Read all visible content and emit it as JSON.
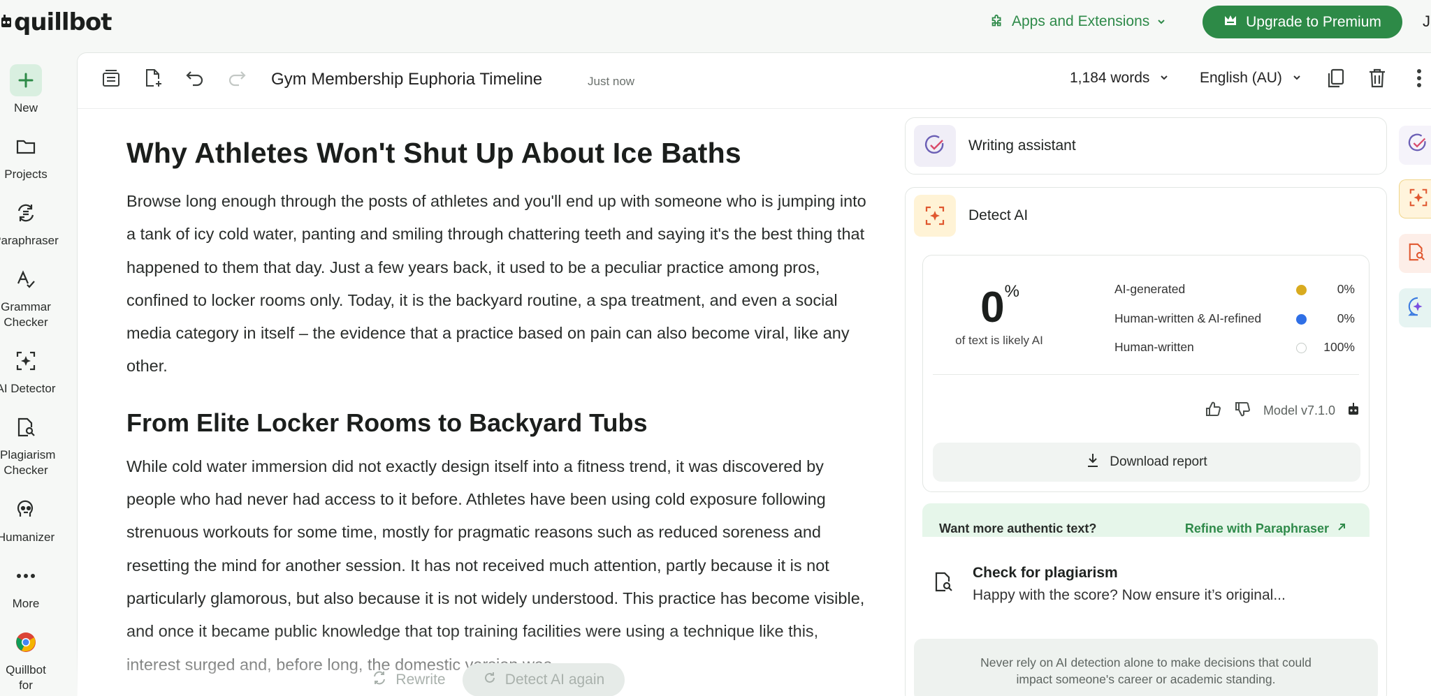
{
  "brand": {
    "logo_text": "quillbot"
  },
  "header": {
    "apps_label": "Apps and Extensions",
    "upgrade_label": "Upgrade to Premium",
    "user_initial": "J"
  },
  "rail": [
    {
      "label": "New",
      "icon": "plus-icon"
    },
    {
      "label": "Projects",
      "icon": "folder-icon"
    },
    {
      "label": "Paraphraser",
      "icon": "paraphraser-icon"
    },
    {
      "label": "Grammar Checker",
      "icon": "grammar-icon"
    },
    {
      "label": "AI Detector",
      "icon": "ai-detector-icon"
    },
    {
      "label": "Plagiarism Checker",
      "icon": "plagiarism-icon"
    },
    {
      "label": "Humanizer",
      "icon": "humanizer-icon"
    },
    {
      "label": "More",
      "icon": "more-icon"
    },
    {
      "label": "Quillbot for Chrome",
      "icon": "chrome-icon"
    }
  ],
  "toolbar": {
    "doc_title": "Gym Membership Euphoria Timeline",
    "saved_status": "Just now",
    "word_count": "1,184 words",
    "language": "English (AU)"
  },
  "article": {
    "h1": "Why Athletes Won't Shut Up About Ice Baths",
    "p1": "Browse long enough through the posts of athletes and you'll end up with someone who is jumping into a tank of icy cold water, panting and smiling through chattering teeth and saying it's the best thing that happened to them that day. Just a few years back, it used to be a peculiar practice among pros, confined to locker rooms only. Today, it is the backyard routine, a spa treatment, and even a social media category in itself – the evidence that a practice based on pain can also become viral, like any other.",
    "h2": "From Elite Locker Rooms to Backyard Tubs",
    "p2": "While cold water immersion did not exactly design itself into a fitness trend, it was discovered by people who had never had access to it before. Athletes have been using cold exposure following strenuous workouts for some time, mostly for pragmatic reasons such as reduced soreness and resetting the mind for another session. It has not received much attention, partly because it is not particularly glamorous, but also because it is not widely understood. This practice has become visible, and once it became public knowledge that top training facilities were using a technique like this, interest surged and, before long, the domestic version was"
  },
  "actions": {
    "rewrite": "Rewrite",
    "detect_again": "Detect AI again"
  },
  "writing_assistant": {
    "title": "Writing assistant"
  },
  "detect_ai": {
    "title": "Detect AI",
    "score": "0",
    "score_unit": "%",
    "score_caption": "of text is likely AI",
    "legend": [
      {
        "label": "AI-generated",
        "value": "0%",
        "color": "#d9ab1f"
      },
      {
        "label": "Human-written & AI-refined",
        "value": "0%",
        "color": "#2f6fe6"
      },
      {
        "label": "Human-written",
        "value": "100%",
        "color": "#ffffff"
      }
    ],
    "model": "Model v7.1.0",
    "download_label": "Download report",
    "refine_question": "Want more authentic text?",
    "refine_link": "Refine with Paraphraser",
    "plagiarism_title": "Check for plagiarism",
    "plagiarism_sub": "Happy with the score? Now ensure it’s original...",
    "disclaimer": "Never rely on AI detection alone to make decisions that could impact someone's career or academic standing."
  }
}
